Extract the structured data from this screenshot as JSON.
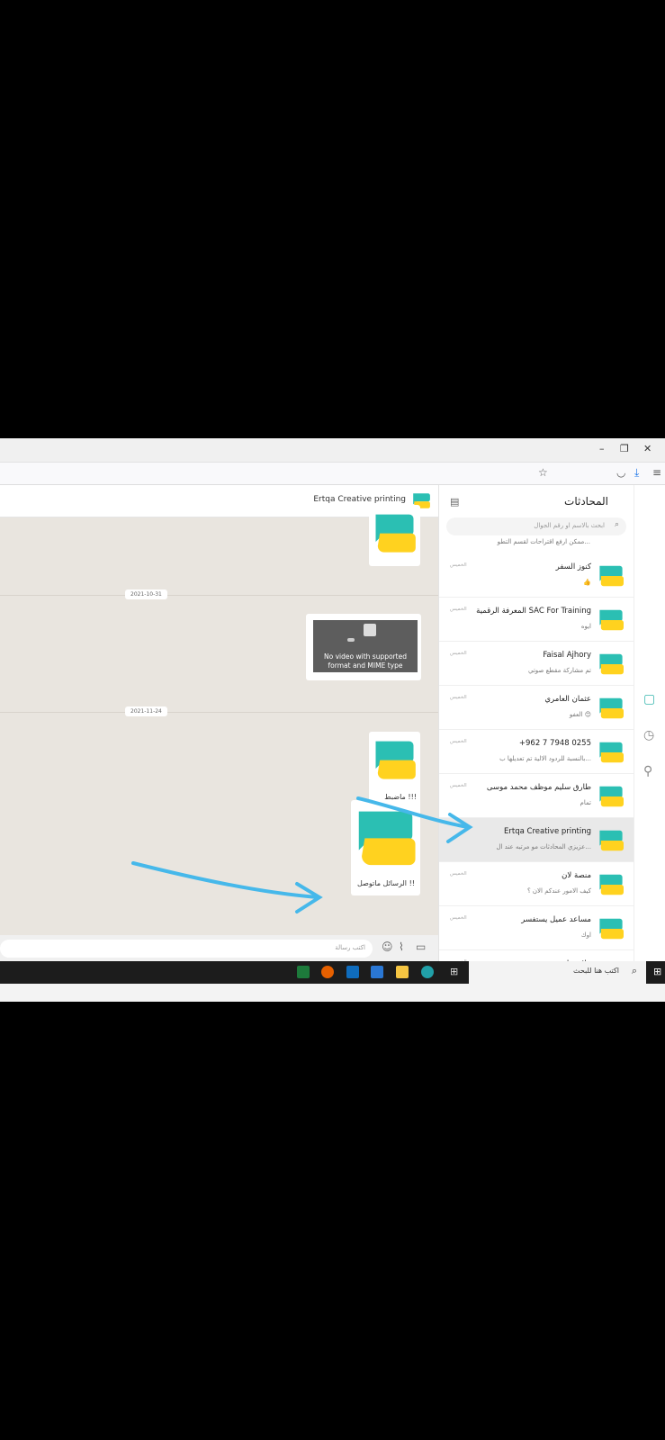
{
  "chat": {
    "title": "Ertqa Creative printing",
    "dates": [
      "2021-10-31",
      "2021-11-24"
    ],
    "video_error": "No video with supported format and MIME type",
    "caption_1": "ماضبط !!!",
    "caption_2": "الرسائل ماتوصل !!",
    "composer_placeholder": "اكتب رسالة"
  },
  "sidebar": {
    "title": "المحادثات",
    "search_placeholder": "ابحث بالاسم او رقم الجوال",
    "partial_preview": "ممكن ارفع اقتراحات لقسم التطو...",
    "conversations": [
      {
        "name": "كنوز السفر",
        "preview": "👍",
        "time": "الخميس"
      },
      {
        "name": "المعرفة الرقمية SAC For Training",
        "preview": "ايوه",
        "time": "الخميس"
      },
      {
        "name": "Faisal Ajhory",
        "preview": "تم مشاركة مقطع صوتي",
        "time": "الخميس"
      },
      {
        "name": "عثمان العامري",
        "preview": "العفو 😊",
        "time": "الخميس"
      },
      {
        "name": "+962 7 7948 0255",
        "preview": "بالنسبة للردود الالية تم تعديلها ب...",
        "time": "الخميس"
      },
      {
        "name": "طارق سليم موظف محمد موسى",
        "preview": "تمام",
        "time": "الخميس"
      },
      {
        "name": "Ertqa Creative printing",
        "preview": "عزيزي المحادثات مو مرتبه عند ال...",
        "time": ""
      },
      {
        "name": "منصة لان",
        "preview": "كيف الامور عندكم الان ؟",
        "time": "الخميس"
      },
      {
        "name": "مساعد عميل يستفسر",
        "preview": "اوك",
        "time": "الخميس"
      },
      {
        "name": "علاء عياش",
        "preview": "",
        "time": "الخميس"
      }
    ]
  },
  "taskbar": {
    "search_text": "اكتب هنا للبحث"
  },
  "colors": {
    "brand_teal": "#2bbfb3",
    "brand_yellow": "#ffd21f",
    "annotation_blue": "#46b8ea"
  }
}
